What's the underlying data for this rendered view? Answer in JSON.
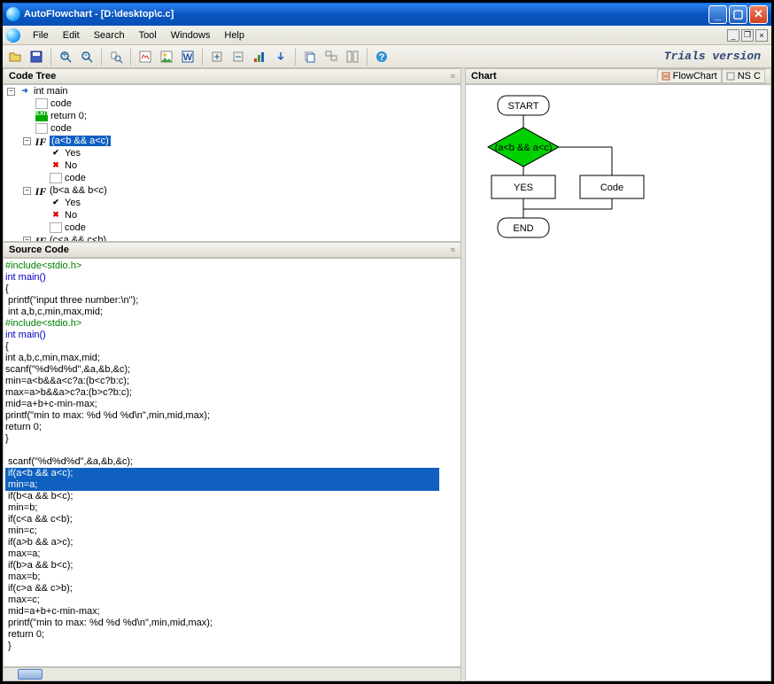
{
  "window": {
    "title": "AutoFlowchart - [D:\\desktop\\c.c]"
  },
  "menu": [
    "File",
    "Edit",
    "Search",
    "Tool",
    "Windows",
    "Help"
  ],
  "trials": "Trials version",
  "panels": {
    "codetree": "Code Tree",
    "sourcecode": "Source Code",
    "chart": "Chart"
  },
  "charttabs": {
    "flowchart": "FlowChart",
    "nsc": "NS C"
  },
  "tree": {
    "root": "int main",
    "n1": "code",
    "n2": "return 0;",
    "n3": "code",
    "if1": "(a<b && a<c)",
    "if1y": "Yes",
    "if1n": "No",
    "if1c": "code",
    "if2": "(b<a && b<c)",
    "if2y": "Yes",
    "if2n": "No",
    "if2c": "code",
    "if3": "(c<a && c<b)"
  },
  "src": {
    "l1": "#include<stdio.h>",
    "l2": "int main()",
    "l3": "{",
    "l4": " printf(\"input three number:\\n\");",
    "l5": " int a,b,c,min,max,mid;",
    "l6": "#include<stdio.h>",
    "l7": "int main()",
    "l8": "{",
    "l9": "int a,b,c,min,max,mid;",
    "l10": "scanf(\"%d%d%d\",&a,&b,&c);",
    "l11": "min=a<b&&a<c?a:(b<c?b:c);",
    "l12": "max=a>b&&a>c?a:(b>c?b:c);",
    "l13": "mid=a+b+c-min-max;",
    "l14": "printf(\"min to max: %d %d %d\\n\",min,mid,max);",
    "l15": "return 0;",
    "l16": "}",
    "l17": "",
    "l18": " scanf(\"%d%d%d\",&a,&b,&c);",
    "l19": " if(a<b && a<c);",
    "l20": " min=a;",
    "l21": " if(b<a && b<c);",
    "l22": " min=b;",
    "l23": " if(c<a && c<b);",
    "l24": " min=c;",
    "l25": " if(a>b && a>c);",
    "l26": " max=a;",
    "l27": " if(b>a && b<c);",
    "l28": " max=b;",
    "l29": " if(c>a && c>b);",
    "l30": " max=c;",
    "l31": " mid=a+b+c-min-max;",
    "l32": " printf(\"min to max: %d %d %d\\n\",min,mid,max);",
    "l33": " return 0;",
    "l34": " }"
  },
  "chart": {
    "start": "START",
    "cond": "(a<b && a<c)",
    "yes": "YES",
    "code": "Code",
    "end": "END"
  },
  "chart_data": {
    "type": "flowchart",
    "nodes": [
      {
        "id": "start",
        "shape": "terminator",
        "label": "START"
      },
      {
        "id": "cond",
        "shape": "decision",
        "label": "(a<b && a<c)",
        "highlighted": true
      },
      {
        "id": "yes",
        "shape": "process",
        "label": "YES"
      },
      {
        "id": "code",
        "shape": "process",
        "label": "Code"
      },
      {
        "id": "end",
        "shape": "terminator",
        "label": "END"
      }
    ],
    "edges": [
      {
        "from": "start",
        "to": "cond"
      },
      {
        "from": "cond",
        "to": "yes",
        "branch": "true"
      },
      {
        "from": "cond",
        "to": "code",
        "branch": "false"
      },
      {
        "from": "yes",
        "to": "end"
      },
      {
        "from": "code",
        "to": "end_join"
      }
    ]
  }
}
